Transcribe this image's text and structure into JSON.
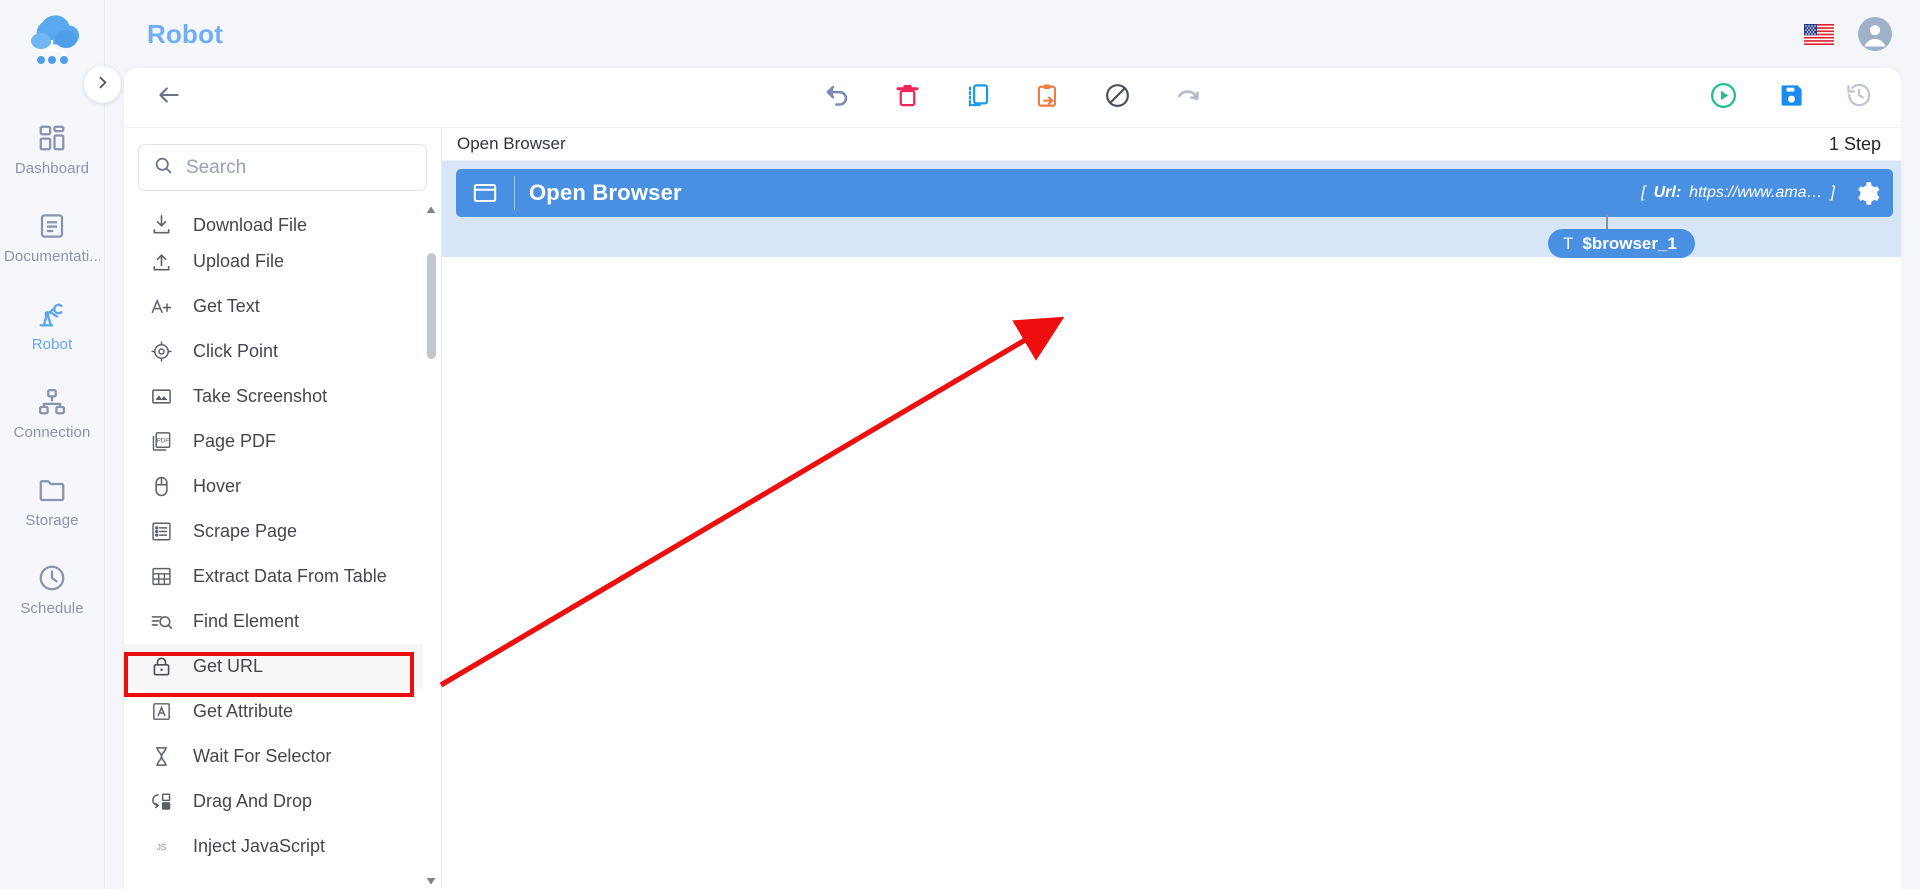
{
  "header": {
    "title": "Robot",
    "flag_icon": "us-flag-icon",
    "avatar_icon": "user-avatar-icon"
  },
  "sidebar": {
    "logo_icon": "cloud-robot-logo-icon",
    "expander_icon": "chevron-right-icon",
    "items": [
      {
        "label": "Dashboard",
        "icon": "dashboard-icon",
        "active": false
      },
      {
        "label": "Documentati...",
        "icon": "document-icon",
        "active": false
      },
      {
        "label": "Robot",
        "icon": "robot-arm-icon",
        "active": true
      },
      {
        "label": "Connection",
        "icon": "connection-icon",
        "active": false
      },
      {
        "label": "Storage",
        "icon": "folder-icon",
        "active": false
      },
      {
        "label": "Schedule",
        "icon": "clock-icon",
        "active": false
      }
    ]
  },
  "toolbar": {
    "back_icon": "arrow-left-icon",
    "buttons": [
      {
        "name": "undo-button",
        "icon": "undo-icon",
        "color": "#7e8bb5"
      },
      {
        "name": "delete-button",
        "icon": "trash-icon",
        "color": "#f0245c"
      },
      {
        "name": "copy-button",
        "icon": "copy-icon",
        "color": "#1a9ae8"
      },
      {
        "name": "paste-button",
        "icon": "clipboard-arrow-icon",
        "color": "#ef7c45"
      },
      {
        "name": "disable-button",
        "icon": "block-icon",
        "color": "#4a4f58"
      },
      {
        "name": "redo-button",
        "icon": "redo-icon",
        "color": "#b7bcc6"
      }
    ],
    "right_buttons": [
      {
        "name": "run-button",
        "icon": "play-circle-icon",
        "color": "#24c08a"
      },
      {
        "name": "save-button",
        "icon": "save-disk-icon",
        "color": "#1a8cf0"
      },
      {
        "name": "history-button",
        "icon": "history-icon",
        "color": "#c0c4cc"
      }
    ]
  },
  "panel": {
    "search": {
      "placeholder": "Search",
      "value": "",
      "icon": "search-icon"
    },
    "scrollbar": {
      "up_icon": "caret-up-icon",
      "down_icon": "caret-down-icon"
    },
    "actions": [
      {
        "label": "Download File",
        "icon": "download-icon",
        "highlighted": false
      },
      {
        "label": "Upload File",
        "icon": "upload-icon",
        "highlighted": false
      },
      {
        "label": "Get Text",
        "icon": "text-plus-icon",
        "highlighted": false
      },
      {
        "label": "Click Point",
        "icon": "target-icon",
        "highlighted": false
      },
      {
        "label": "Take Screenshot",
        "icon": "image-icon",
        "highlighted": false
      },
      {
        "label": "Page PDF",
        "icon": "pdf-icon",
        "highlighted": false
      },
      {
        "label": "Hover",
        "icon": "mouse-icon",
        "highlighted": false
      },
      {
        "label": "Scrape Page",
        "icon": "list-icon",
        "highlighted": false
      },
      {
        "label": "Extract Data From Table",
        "icon": "table-icon",
        "highlighted": false
      },
      {
        "label": "Find Element",
        "icon": "find-element-icon",
        "highlighted": false
      },
      {
        "label": "Get URL",
        "icon": "lock-icon",
        "highlighted": true
      },
      {
        "label": "Get Attribute",
        "icon": "letter-a-box-icon",
        "highlighted": false
      },
      {
        "label": "Wait For Selector",
        "icon": "hourglass-icon",
        "highlighted": false
      },
      {
        "label": "Drag And Drop",
        "icon": "drag-drop-icon",
        "highlighted": false
      },
      {
        "label": "Inject JavaScript",
        "icon": "js-icon",
        "highlighted": false
      }
    ]
  },
  "canvas": {
    "flow_name": "Open Browser",
    "step_count": "1 Step",
    "step": {
      "icon": "browser-window-icon",
      "name": "Open Browser",
      "param_open": "[",
      "param_key": "Url:",
      "param_value": "https://www.ama…",
      "param_close": "]",
      "gear_icon": "gear-icon",
      "variable": {
        "type_glyph": "T",
        "name": "$browser_1"
      }
    }
  },
  "annotation": {
    "color": "#ee0e0e",
    "target": "Get URL"
  }
}
